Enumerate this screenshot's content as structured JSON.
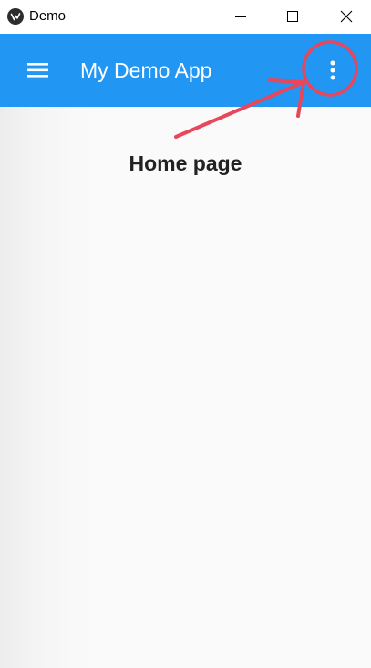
{
  "window": {
    "title": "Demo",
    "controls": [
      "minimize-icon",
      "maximize-icon",
      "close-icon"
    ]
  },
  "appbar": {
    "title": "My Demo App",
    "left_icon": "hamburger-menu-icon",
    "right_icon": "more-vert-icon",
    "color": "#2196f3"
  },
  "main": {
    "heading": "Home page"
  },
  "annotation": {
    "color": "#e8465a",
    "shapes": [
      "circle",
      "arrow",
      "arrow"
    ]
  }
}
